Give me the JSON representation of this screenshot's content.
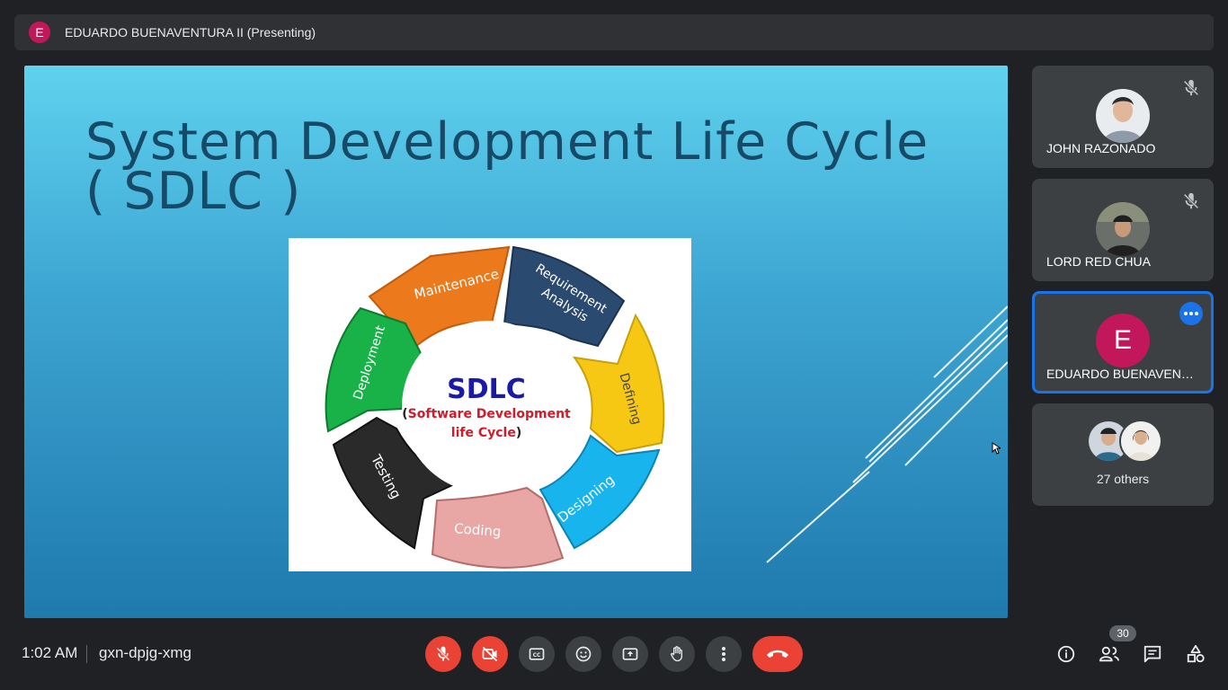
{
  "presenter_bar": {
    "avatar_letter": "E",
    "text": "EDUARDO BUENAVENTURA II (Presenting)"
  },
  "slide": {
    "title_line1": "System Development Life Cycle",
    "title_line2": "( SDLC )",
    "diagram": {
      "center_title": "SDLC",
      "center_sub_open": "(",
      "center_sub": "Software Development",
      "center_sub2": "life Cycle",
      "center_sub_close": ")",
      "phases": {
        "maintenance": "Maintenance",
        "requirement1": "Requirement",
        "requirement2": "Analysis",
        "defining": "Defining",
        "designing": "Designing",
        "coding": "Coding",
        "testing": "Testing",
        "deployment": "Deployment"
      },
      "colors": {
        "maintenance": "#ec7a1c",
        "requirement": "#2b4a6f",
        "defining": "#f6c814",
        "designing": "#17b4ee",
        "coding": "#e8a6a4",
        "testing": "#2a2a2a",
        "deployment": "#19b248",
        "center_title": "#1a1aa8",
        "center_sub": "#d11a2a"
      }
    }
  },
  "participants": [
    {
      "name": "JOHN RAZONADO",
      "muted": true
    },
    {
      "name": "LORD RED CHUA",
      "muted": true
    },
    {
      "name": "EDUARDO BUENAVENTURA II",
      "avatar_letter": "E",
      "active": true
    }
  ],
  "others": {
    "label": "27 others"
  },
  "bottom": {
    "time": "1:02 AM",
    "meeting_code": "gxn-dpjg-xmg",
    "participant_count": "30"
  }
}
